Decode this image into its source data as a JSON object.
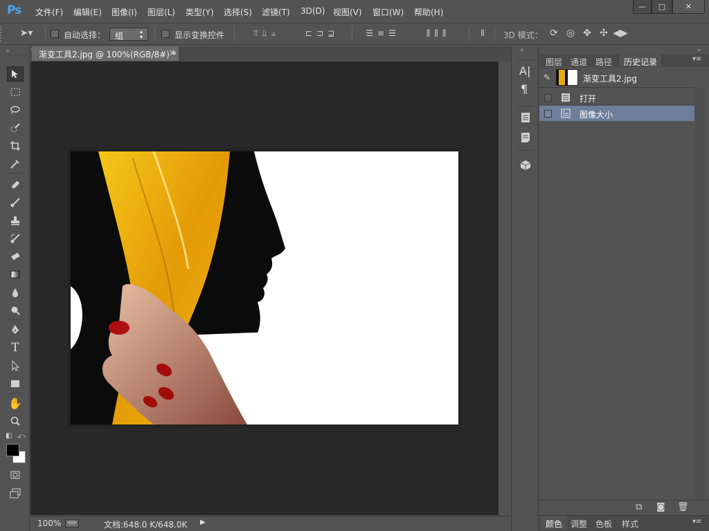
{
  "app": {
    "logo": "Ps",
    "menu": [
      "文件(F)",
      "编辑(E)",
      "图像(I)",
      "图层(L)",
      "类型(Y)",
      "选择(S)",
      "滤镜(T)",
      "3D(D)",
      "视图(V)",
      "窗口(W)",
      "帮助(H)"
    ],
    "window_buttons": {
      "minimize": "—",
      "restore": "□",
      "close": "✕"
    }
  },
  "options_bar": {
    "auto_select_label": "自动选择：",
    "auto_select_value": "组",
    "show_transform_label": "显示变换控件",
    "mode_3d_label": "3D 模式："
  },
  "document": {
    "tab_title": "渐变工具2.jpg @ 100%(RGB/8#) *",
    "close_glyph": "×"
  },
  "status": {
    "zoom": "100%",
    "doc_info": "文档:648.0 K/648.0K"
  },
  "panels": {
    "tabs": [
      "图层",
      "通道",
      "路径",
      "历史记录"
    ],
    "active_tab": "历史记录",
    "snapshot_name": "渐变工具2.jpg",
    "history": [
      {
        "label": "打开",
        "selected": false
      },
      {
        "label": "图像大小",
        "selected": true
      }
    ],
    "bottom_tabs": [
      "颜色",
      "调整",
      "色板",
      "样式"
    ]
  },
  "colors": {
    "app_bg": "#535353",
    "canvas_bg": "#282828",
    "selection": "#6e7d9a",
    "logo_blue": "#4fa3e6"
  }
}
